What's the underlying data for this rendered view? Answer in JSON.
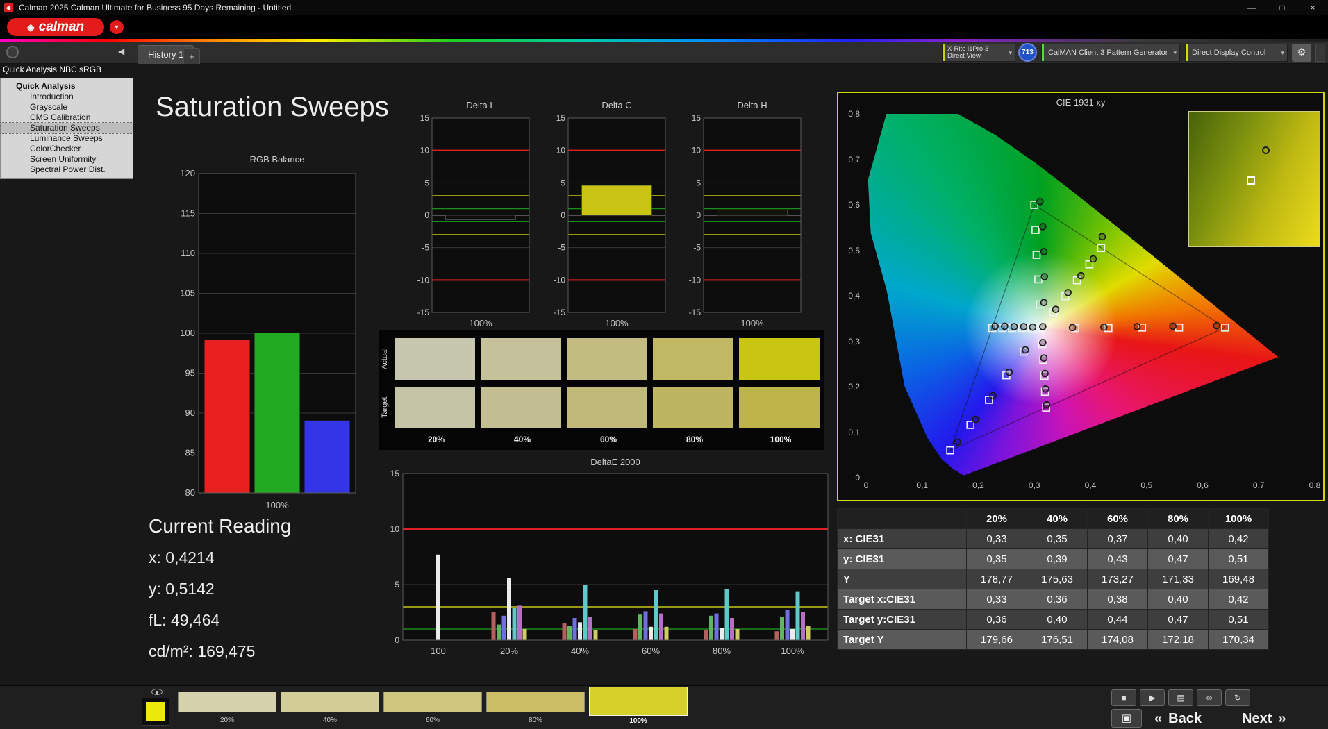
{
  "window": {
    "title": "Calman 2025 Calman Ultimate for Business 95 Days Remaining  - Untitled",
    "minimize": "—",
    "maximize": "□",
    "close": "×"
  },
  "icons": {
    "diamond": "◈",
    "logo_chevron": "▼",
    "chevron": "▾",
    "collapse": "◀",
    "gear": "⚙",
    "add_tab": "+"
  },
  "brand": {
    "logo_text": "calman"
  },
  "tabbar": {
    "tabs": [
      "History 1"
    ],
    "add": "+"
  },
  "devices": {
    "meter": {
      "line1": "X-Rite i1Pro 3",
      "line2": "Direct View",
      "accent": "#c8d400"
    },
    "badge": "713",
    "badge_color": "#2053c8",
    "source": {
      "label": "CalMAN Client 3 Pattern Generator",
      "accent": "#55dd33"
    },
    "display": {
      "label": "Direct Display Control",
      "accent": "#d8e000"
    }
  },
  "sidebar": {
    "header": "Quick Analysis NBC sRGB",
    "root": "Quick Analysis",
    "items": [
      "Introduction",
      "Grayscale",
      "CMS Calibration",
      "Saturation Sweeps",
      "Luminance Sweeps",
      "ColorChecker",
      "Screen Uniformity",
      "Spectral Power Dist."
    ],
    "selected": "Saturation Sweeps"
  },
  "page": {
    "title": "Saturation Sweeps"
  },
  "current_reading": {
    "title": "Current Reading",
    "x": "x: 0,4214",
    "y": "y: 0,5142",
    "fl": "fL: 49,464",
    "cdm2": "cd/m²: 169,475"
  },
  "swatch_strip": {
    "rows": [
      {
        "label": "Actual",
        "colors": [
          "#c7c7b0",
          "#c5c19a",
          "#c2bc80",
          "#c0b862",
          "#c9c513"
        ]
      },
      {
        "label": "Target",
        "colors": [
          "#c4c3a6",
          "#c2be92",
          "#c0b97a",
          "#bdb560",
          "#bdb44a"
        ]
      }
    ],
    "columns": [
      "20%",
      "40%",
      "60%",
      "80%",
      "100%"
    ]
  },
  "chart_data": [
    {
      "type": "bar",
      "title": "RGB Balance",
      "categories": [
        "Red",
        "Green",
        "Blue"
      ],
      "values": [
        99.2,
        100.1,
        89.1
      ],
      "colors": [
        "#e82020",
        "#22aa22",
        "#3535e8"
      ],
      "ylim": [
        80,
        120
      ],
      "ytick_step": 5,
      "xlabel": "100%"
    },
    {
      "type": "delta-bar",
      "title": "Delta L",
      "value": -0.7,
      "bar_color": "#0e0e0e",
      "ylim": [
        -15,
        15
      ],
      "ytick_step": 5,
      "limits": {
        "red": 10,
        "yellow": 3,
        "green": 1
      },
      "xlabel": "100%"
    },
    {
      "type": "delta-bar",
      "title": "Delta C",
      "value": 4.6,
      "bar_color": "#c9c414",
      "ylim": [
        -15,
        15
      ],
      "ytick_step": 5,
      "limits": {
        "red": 10,
        "yellow": 3,
        "green": 1
      },
      "xlabel": "100%"
    },
    {
      "type": "delta-bar",
      "title": "Delta H",
      "value": 0.8,
      "bar_color": "#14140c",
      "ylim": [
        -15,
        15
      ],
      "ytick_step": 5,
      "limits": {
        "red": 10,
        "yellow": 3,
        "green": 1
      },
      "xlabel": "100%"
    },
    {
      "type": "grouped-bar",
      "title": "DeltaE 2000",
      "ylim": [
        0,
        15
      ],
      "yticks": [
        0,
        5,
        10,
        15
      ],
      "limits": {
        "red": 10,
        "yellow": 3,
        "green": 1
      },
      "groups": [
        {
          "label": "100",
          "colors": [
            "#ececec"
          ],
          "values": [
            7.7
          ]
        },
        {
          "label": "20%",
          "colors": [
            "#b65f5f",
            "#5fb65f",
            "#6f6fe2",
            "#ececec",
            "#5fc9c9",
            "#b66fc2",
            "#cdcd63"
          ],
          "values": [
            2.5,
            1.4,
            2.2,
            5.6,
            2.9,
            3.1,
            1.0
          ]
        },
        {
          "label": "40%",
          "colors": [
            "#b65f5f",
            "#5fb65f",
            "#6f6fe2",
            "#ececec",
            "#5fc9c9",
            "#b66fc2",
            "#cdcd63"
          ],
          "values": [
            1.5,
            1.3,
            2.0,
            1.6,
            5.0,
            2.1,
            0.9
          ]
        },
        {
          "label": "60%",
          "colors": [
            "#b65f5f",
            "#5fb65f",
            "#6f6fe2",
            "#ececec",
            "#5fc9c9",
            "#b66fc2",
            "#cdcd63"
          ],
          "values": [
            1.0,
            2.3,
            2.6,
            1.2,
            4.5,
            2.4,
            1.2
          ]
        },
        {
          "label": "80%",
          "colors": [
            "#b65f5f",
            "#5fb65f",
            "#6f6fe2",
            "#ececec",
            "#5fc9c9",
            "#b66fc2",
            "#cdcd63"
          ],
          "values": [
            0.9,
            2.2,
            2.4,
            1.1,
            4.6,
            2.0,
            1.0
          ]
        },
        {
          "label": "100%",
          "colors": [
            "#b65f5f",
            "#5fb65f",
            "#6f6fe2",
            "#ececec",
            "#5fc9c9",
            "#b66fc2",
            "#cdcd63"
          ],
          "values": [
            0.8,
            2.1,
            2.7,
            1.0,
            4.4,
            2.5,
            1.3
          ]
        }
      ]
    },
    {
      "type": "cie-xy",
      "title": "CIE 1931 xy",
      "xlim": [
        0,
        0.8
      ],
      "ylim": [
        0,
        0.8
      ],
      "tick_labels": [
        "0",
        "0,1",
        "0,2",
        "0,3",
        "0,4",
        "0,5",
        "0,6",
        "0,7",
        "0,8"
      ],
      "white_point": [
        0.3127,
        0.329
      ],
      "gamut_triangle": [
        [
          0.64,
          0.33
        ],
        [
          0.3,
          0.6
        ],
        [
          0.15,
          0.06
        ]
      ],
      "locus": [
        [
          0.1741,
          0.005
        ],
        [
          0.1566,
          0.0177
        ],
        [
          0.1355,
          0.0399
        ],
        [
          0.1096,
          0.0868
        ],
        [
          0.0687,
          0.2007
        ],
        [
          0.0369,
          0.4112
        ],
        [
          0.0082,
          0.5384
        ],
        [
          0.0034,
          0.6548
        ],
        [
          0.0389,
          0.812
        ],
        [
          0.0743,
          0.8338
        ],
        [
          0.1547,
          0.8059
        ],
        [
          0.2296,
          0.7543
        ],
        [
          0.3016,
          0.6923
        ],
        [
          0.3731,
          0.6245
        ],
        [
          0.4441,
          0.5547
        ],
        [
          0.5125,
          0.4866
        ],
        [
          0.5752,
          0.4242
        ],
        [
          0.627,
          0.3725
        ],
        [
          0.6915,
          0.3083
        ],
        [
          0.7347,
          0.2653
        ]
      ],
      "targets": [
        [
          0.313,
          0.329
        ],
        [
          0.373,
          0.329
        ],
        [
          0.432,
          0.329
        ],
        [
          0.492,
          0.33
        ],
        [
          0.558,
          0.33
        ],
        [
          0.64,
          0.33
        ],
        [
          0.31,
          0.381
        ],
        [
          0.307,
          0.436
        ],
        [
          0.304,
          0.49
        ],
        [
          0.302,
          0.545
        ],
        [
          0.3,
          0.6
        ],
        [
          0.281,
          0.277
        ],
        [
          0.25,
          0.225
        ],
        [
          0.219,
          0.171
        ],
        [
          0.186,
          0.116
        ],
        [
          0.15,
          0.06
        ],
        [
          0.334,
          0.364
        ],
        [
          0.355,
          0.399
        ],
        [
          0.376,
          0.434
        ],
        [
          0.398,
          0.469
        ],
        [
          0.419,
          0.505
        ],
        [
          0.295,
          0.329
        ],
        [
          0.278,
          0.329
        ],
        [
          0.26,
          0.329
        ],
        [
          0.243,
          0.329
        ],
        [
          0.225,
          0.329
        ],
        [
          0.314,
          0.294
        ],
        [
          0.316,
          0.259
        ],
        [
          0.318,
          0.224
        ],
        [
          0.319,
          0.189
        ],
        [
          0.321,
          0.154
        ]
      ],
      "measured": [
        [
          0.315,
          0.332
        ],
        [
          0.368,
          0.33
        ],
        [
          0.424,
          0.331
        ],
        [
          0.483,
          0.332
        ],
        [
          0.547,
          0.333
        ],
        [
          0.625,
          0.334
        ],
        [
          0.317,
          0.385
        ],
        [
          0.318,
          0.442
        ],
        [
          0.317,
          0.497
        ],
        [
          0.315,
          0.552
        ],
        [
          0.31,
          0.607
        ],
        [
          0.284,
          0.281
        ],
        [
          0.255,
          0.232
        ],
        [
          0.226,
          0.18
        ],
        [
          0.195,
          0.128
        ],
        [
          0.163,
          0.078
        ],
        [
          0.338,
          0.37
        ],
        [
          0.36,
          0.407
        ],
        [
          0.383,
          0.444
        ],
        [
          0.405,
          0.481
        ],
        [
          0.421,
          0.53
        ],
        [
          0.297,
          0.331
        ],
        [
          0.281,
          0.332
        ],
        [
          0.264,
          0.332
        ],
        [
          0.247,
          0.333
        ],
        [
          0.23,
          0.333
        ],
        [
          0.315,
          0.297
        ],
        [
          0.317,
          0.263
        ],
        [
          0.319,
          0.229
        ],
        [
          0.32,
          0.195
        ],
        [
          0.322,
          0.16
        ]
      ]
    }
  ],
  "table": {
    "columns": [
      "20%",
      "40%",
      "60%",
      "80%",
      "100%"
    ],
    "rows": [
      {
        "label": "x: CIE31",
        "values": [
          "0,33",
          "0,35",
          "0,37",
          "0,40",
          "0,42"
        ]
      },
      {
        "label": "y: CIE31",
        "values": [
          "0,35",
          "0,39",
          "0,43",
          "0,47",
          "0,51"
        ]
      },
      {
        "label": "Y",
        "values": [
          "178,77",
          "175,63",
          "173,27",
          "171,33",
          "169,48"
        ]
      },
      {
        "label": "Target x:CIE31",
        "values": [
          "0,33",
          "0,36",
          "0,38",
          "0,40",
          "0,42"
        ]
      },
      {
        "label": "Target y:CIE31",
        "values": [
          "0,36",
          "0,40",
          "0,44",
          "0,47",
          "0,51"
        ]
      },
      {
        "label": "Target Y",
        "values": [
          "179,66",
          "176,51",
          "174,08",
          "172,18",
          "170,34"
        ]
      }
    ]
  },
  "bottom": {
    "pattern_color": "#ece80c",
    "swatches": [
      {
        "label": "20%",
        "color": "#d6d2ae"
      },
      {
        "label": "40%",
        "color": "#d2cc97"
      },
      {
        "label": "60%",
        "color": "#cec67e"
      },
      {
        "label": "80%",
        "color": "#cabf66"
      },
      {
        "label": "100%",
        "color": "#d8d02a"
      }
    ],
    "active": "100%",
    "controls": [
      {
        "name": "stop",
        "glyph": "■"
      },
      {
        "name": "play",
        "glyph": "▶"
      },
      {
        "name": "save",
        "glyph": "▤"
      },
      {
        "name": "link",
        "glyph": "∞"
      },
      {
        "name": "loop",
        "glyph": "↻"
      }
    ],
    "pattern_window_glyph": "▣",
    "back": "Back",
    "next": "Next",
    "back_symbol": "«",
    "next_symbol": "»"
  }
}
